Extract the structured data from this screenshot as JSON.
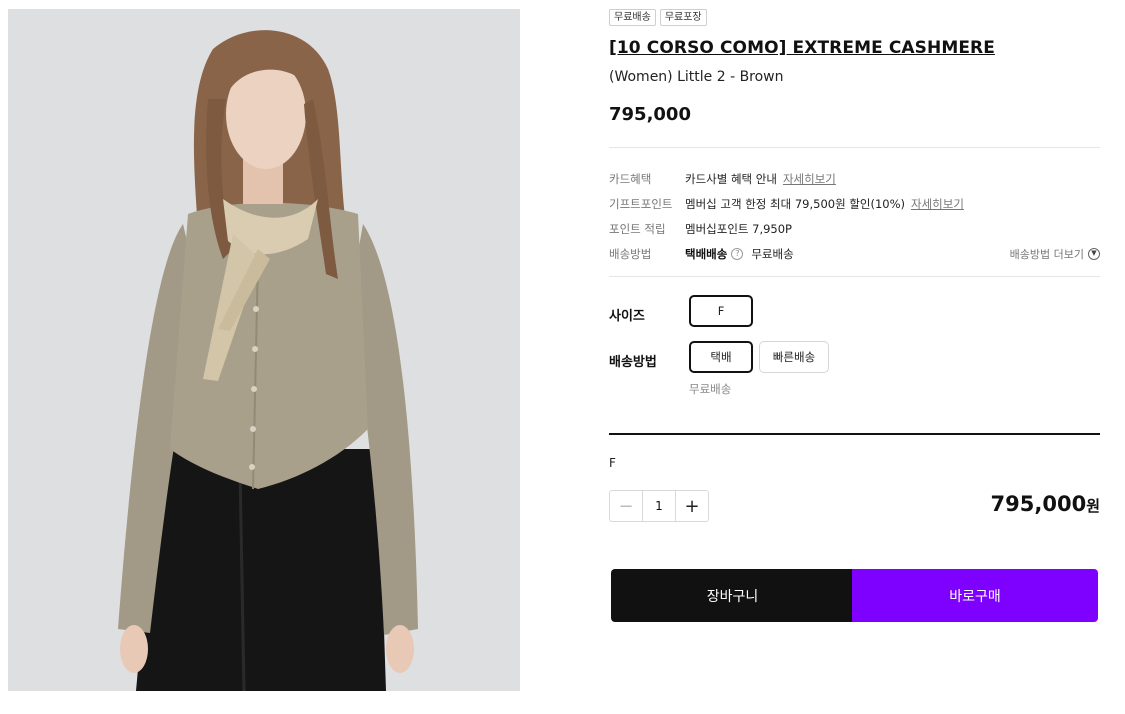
{
  "product": {
    "image_alt": "Model wearing taupe knit cardigan with cream scarf and black trousers",
    "tags": [
      "무료배송",
      "무료포장"
    ],
    "title": "[10 CORSO COMO] EXTREME CASHMERE",
    "subtitle": "(Women) Little 2 - Brown",
    "price": "795,000"
  },
  "benefits": {
    "card": {
      "label": "카드혜택",
      "value": "카드사별 혜택 안내",
      "link": "자세히보기"
    },
    "gift_point": {
      "label": "기프트포인트",
      "value": "멤버십 고객 한정 최대 79,500원 할인(10%)",
      "link": "자세히보기"
    },
    "point": {
      "label": "포인트 적립",
      "value": "멤버십포인트 7,950P"
    },
    "shipping": {
      "label": "배송방법",
      "method": "택배배송",
      "help_icon": "?",
      "fee": "무료배송",
      "more_label": "배송방법 더보기",
      "more_icon": "chevron-down-circle-icon"
    }
  },
  "options": {
    "size": {
      "label": "사이즈",
      "choices": [
        "F"
      ],
      "selected": "F"
    },
    "delivery": {
      "label": "배송방법",
      "choices": [
        "택배",
        "빠른배송"
      ],
      "selected": "택배",
      "note": "무료배송"
    }
  },
  "selection": {
    "name": "F",
    "quantity": "1",
    "minus": "−",
    "plus": "+",
    "total_amount": "795,000",
    "currency": "원"
  },
  "actions": {
    "cart": "장바구니",
    "buy": "바로구매"
  },
  "colors": {
    "buy_button": "#7e00ff",
    "cart_button": "#111111"
  }
}
